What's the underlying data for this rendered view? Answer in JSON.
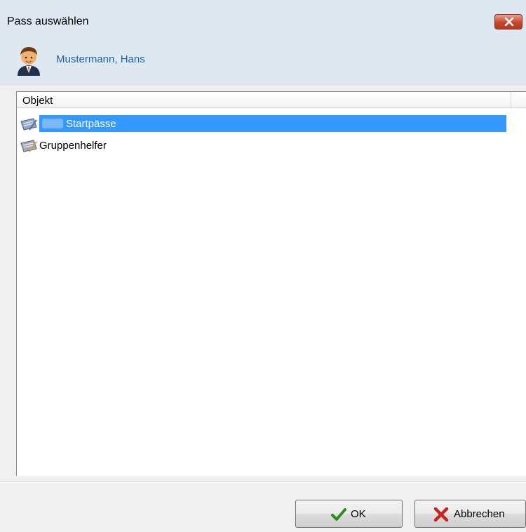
{
  "window": {
    "title": "Pass auswählen",
    "close_icon": "close-x-icon"
  },
  "user": {
    "name": "Mustermann, Hans",
    "avatar_icon": "person-avatar-icon"
  },
  "list": {
    "columns": [
      "Objekt"
    ],
    "items": [
      {
        "label": "Startpässe",
        "icon": "pass-card-icon",
        "selected": true
      },
      {
        "label": "Gruppenhelfer",
        "icon": "pass-card-icon",
        "selected": false
      }
    ],
    "selection_color": "#3399ff"
  },
  "buttons": {
    "ok_label": "OK",
    "ok_icon": "checkmark-icon",
    "cancel_label": "Abbrechen",
    "cancel_icon": "red-x-icon"
  }
}
